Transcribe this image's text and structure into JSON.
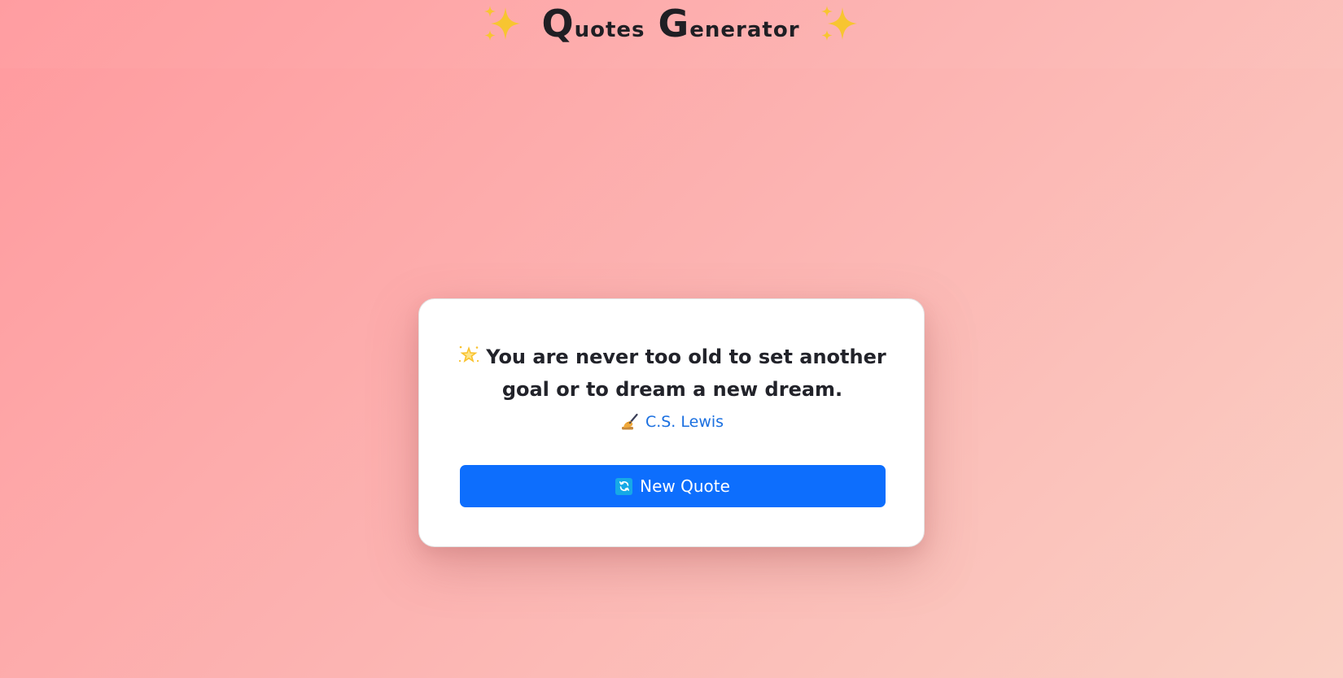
{
  "header": {
    "sparkle_left": "sparkles-icon",
    "sparkle_right": "sparkles-icon",
    "title_word1_cap": "Q",
    "title_word1_rest": "uotes",
    "title_word2_cap": "G",
    "title_word2_rest": "enerator"
  },
  "quote": {
    "emoji": "glowing-star-icon",
    "text": "You are never too old to set another goal or to dream a new dream.",
    "author_icon": "writing-hand-icon",
    "author": "C.S. Lewis"
  },
  "button": {
    "icon": "refresh-icon",
    "label": "New Quote"
  },
  "colors": {
    "accent": "#0d6efd",
    "author": "#1a6fe0",
    "gradient_start": "#ff9a9e",
    "gradient_end": "#fad0c4",
    "sparkle": "#f7c531"
  }
}
